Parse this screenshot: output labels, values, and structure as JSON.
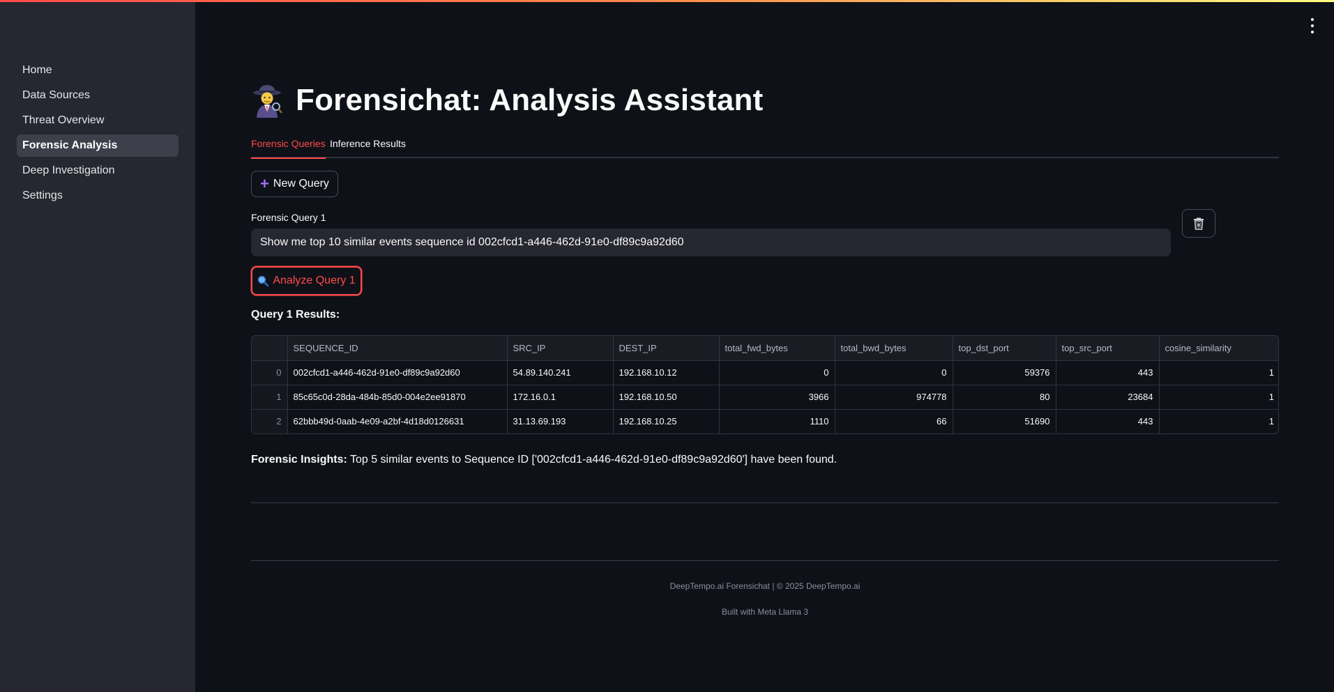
{
  "sidebar": {
    "items": [
      {
        "label": "Home"
      },
      {
        "label": "Data Sources"
      },
      {
        "label": "Threat Overview"
      },
      {
        "label": "Forensic Analysis",
        "active": true
      },
      {
        "label": "Deep Investigation"
      },
      {
        "label": "Settings"
      }
    ]
  },
  "header": {
    "title": "Forensichat: Analysis Assistant",
    "icon": "detective-emoji"
  },
  "tabs": [
    {
      "label": "Forensic Queries",
      "active": true
    },
    {
      "label": "Inference Results"
    }
  ],
  "actions": {
    "new_query_label": "New Query",
    "analyze_label": "Analyze Query 1"
  },
  "query": {
    "label": "Forensic Query 1",
    "value": "Show me top 10 similar events sequence id 002cfcd1-a446-462d-91e0-df89c9a92d60"
  },
  "results": {
    "title": "Query 1 Results:",
    "columns": [
      "",
      "SEQUENCE_ID",
      "SRC_IP",
      "DEST_IP",
      "total_fwd_bytes",
      "total_bwd_bytes",
      "top_dst_port",
      "top_src_port",
      "cosine_similarity"
    ],
    "rows": [
      [
        "0",
        "002cfcd1-a446-462d-91e0-df89c9a92d60",
        "54.89.140.241",
        "192.168.10.12",
        "0",
        "0",
        "59376",
        "443",
        "1"
      ],
      [
        "1",
        "85c65c0d-28da-484b-85d0-004e2ee91870",
        "172.16.0.1",
        "192.168.10.50",
        "3966",
        "974778",
        "80",
        "23684",
        "1"
      ],
      [
        "2",
        "62bbb49d-0aab-4e09-a2bf-4d18d0126631",
        "31.13.69.193",
        "192.168.10.25",
        "1110",
        "66",
        "51690",
        "443",
        "1"
      ]
    ]
  },
  "insights": {
    "label": "Forensic Insights:",
    "text": " Top 5 similar events to Sequence ID ['002cfcd1-a446-462d-91e0-df89c9a92d60'] have been found."
  },
  "footer": {
    "line1": "DeepTempo.ai Forensichat | © 2025 DeepTempo.ai",
    "line2": "Built with Meta Llama 3"
  },
  "colors": {
    "background": "#0e1117",
    "sidebar": "#262730",
    "accent": "#ff4b4b",
    "plus_icon": "#a371f7"
  }
}
